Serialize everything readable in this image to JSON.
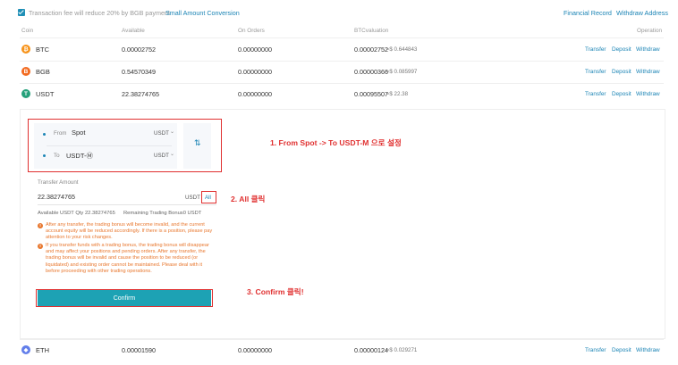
{
  "topbar": {
    "fee_notice": "Transaction fee will reduce 20% by BGB payment",
    "small_conversion": "Small Amount Conversion",
    "financial_record": "Financial Record",
    "withdraw_address": "Withdraw Address"
  },
  "table": {
    "headers": {
      "coin": "Coin",
      "available": "Available",
      "on_orders": "On Orders",
      "btc_valuation": "BTCvaluation",
      "operation": "Operation"
    },
    "rows": [
      {
        "coin": "BTC",
        "icon": "btc-icon",
        "color": "#f7931a",
        "glyph": "₿",
        "available": "0.00002752",
        "on_orders": "0.00000000",
        "btc": "0.00002752",
        "usd": "≈$ 0.644843"
      },
      {
        "coin": "BGB",
        "icon": "bgb-icon",
        "color": "#f26b21",
        "glyph": "B",
        "available": "0.54570349",
        "on_orders": "0.00000000",
        "btc": "0.00000366",
        "usd": "≈$ 0.085997"
      },
      {
        "coin": "USDT",
        "icon": "usdt-icon",
        "color": "#26a17b",
        "glyph": "T",
        "available": "22.38274765",
        "on_orders": "0.00000000",
        "btc": "0.00095507",
        "usd": "≈$ 22.38"
      },
      {
        "coin": "ETH",
        "icon": "eth-icon",
        "color": "#627eea",
        "glyph": "◆",
        "available": "0.00001590",
        "on_orders": "0.00000000",
        "btc": "0.00000124",
        "usd": "≈$ 0.029271"
      }
    ],
    "ops": {
      "transfer": "Transfer",
      "deposit": "Deposit",
      "withdraw": "Withdraw"
    }
  },
  "transfer": {
    "from_label": "From",
    "from_value": "Spot",
    "from_coin": "USDT",
    "to_label": "To",
    "to_value": "USDT-Ⓜ",
    "to_coin": "USDT",
    "amount_label": "Transfer Amount",
    "amount_value": "22.38274765",
    "amount_unit": "USDT",
    "all_label": "All",
    "available_qty": "Available USDT Qty 22.38274765",
    "remaining_bonus": "Remaining Trading Bonus0 USDT",
    "warning1": "After any transfer, the trading bonus will become invalid, and the current account equity will be reduced accordingly. If there is a position, please pay attention to your risk changes.",
    "warning2": "If you transfer funds with a trading bonus, the trading bonus will disappear and may affect your positions and pending orders. After any transfer, the trading bonus will be invalid and cause the position to be reduced (or liquidated) and existing order cannot be maintained. Please deal with it before proceeding with other trading operations.",
    "confirm_label": "Confirm"
  },
  "annotations": {
    "step1": "1. From Spot -> To USDT-M 으로 설정",
    "step2": "2. All 클릭",
    "step3": "3. Confirm 클릭!"
  },
  "colors": {
    "accent": "#1b84b5",
    "confirm": "#1da2b4",
    "annotation": "#e03030",
    "warning": "#e8772e"
  }
}
